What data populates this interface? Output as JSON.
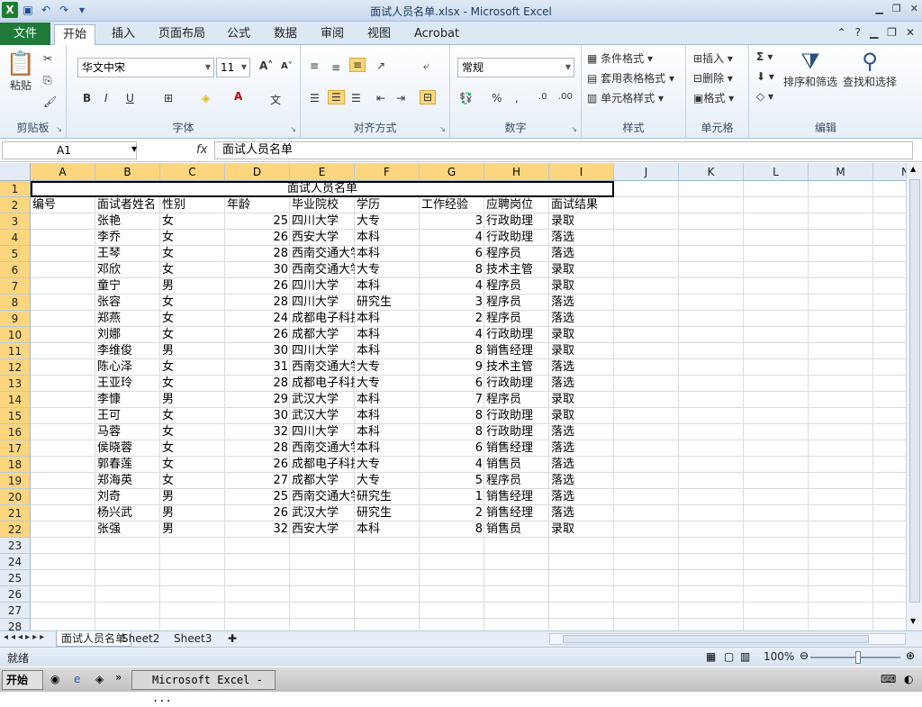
{
  "window": {
    "title": "面试人员名单.xlsx - Microsoft Excel"
  },
  "ribbon_tabs": [
    "文件",
    "开始",
    "插入",
    "页面布局",
    "公式",
    "数据",
    "审阅",
    "视图",
    "Acrobat"
  ],
  "clipboard": {
    "paste": "粘贴",
    "group": "剪贴板"
  },
  "font": {
    "name": "华文中宋",
    "size": "11",
    "group": "字体"
  },
  "alignment": {
    "group": "对齐方式"
  },
  "number": {
    "format": "常规",
    "group": "数字"
  },
  "styles": {
    "conditional": "条件格式",
    "table": "套用表格格式",
    "cell": "单元格样式",
    "group": "样式"
  },
  "cells": {
    "insert": "插入",
    "delete": "删除",
    "format": "格式",
    "group": "单元格"
  },
  "editing": {
    "sort": "排序和筛选",
    "find": "查找和选择",
    "group": "编辑"
  },
  "formula_bar": {
    "namebox": "A1",
    "fx": "fx",
    "content": "面试人员名单"
  },
  "columns": [
    "A",
    "B",
    "C",
    "D",
    "E",
    "F",
    "G",
    "H",
    "I",
    "J",
    "K",
    "L",
    "M",
    "N"
  ],
  "rows": [
    "1",
    "2",
    "3",
    "4",
    "5",
    "6",
    "7",
    "8",
    "9",
    "10",
    "11",
    "12",
    "13",
    "14",
    "15",
    "16",
    "17",
    "18",
    "19",
    "20",
    "21",
    "22",
    "23",
    "24",
    "25",
    "26",
    "27",
    "28"
  ],
  "sheet_title": "面试人员名单",
  "headers": [
    "编号",
    "面试者姓名",
    "性别",
    "年龄",
    "毕业院校",
    "学历",
    "工作经验",
    "应聘岗位",
    "面试结果"
  ],
  "records": [
    [
      "张艳",
      "女",
      "25",
      "四川大学",
      "大专",
      "3",
      "行政助理",
      "录取"
    ],
    [
      "李乔",
      "女",
      "26",
      "西安大学",
      "本科",
      "4",
      "行政助理",
      "落选"
    ],
    [
      "王琴",
      "女",
      "28",
      "西南交通大学",
      "本科",
      "6",
      "程序员",
      "落选"
    ],
    [
      "邓欣",
      "女",
      "30",
      "西南交通大学",
      "大专",
      "8",
      "技术主管",
      "录取"
    ],
    [
      "童宁",
      "男",
      "26",
      "四川大学",
      "本科",
      "4",
      "程序员",
      "录取"
    ],
    [
      "张容",
      "女",
      "28",
      "四川大学",
      "研究生",
      "3",
      "程序员",
      "落选"
    ],
    [
      "郑燕",
      "女",
      "24",
      "成都电子科技大学",
      "本科",
      "2",
      "程序员",
      "落选"
    ],
    [
      "刘娜",
      "女",
      "26",
      "成都大学",
      "本科",
      "4",
      "行政助理",
      "录取"
    ],
    [
      "李维俊",
      "男",
      "30",
      "四川大学",
      "本科",
      "8",
      "销售经理",
      "录取"
    ],
    [
      "陈心泽",
      "女",
      "31",
      "西南交通大学",
      "大专",
      "9",
      "技术主管",
      "落选"
    ],
    [
      "王亚玲",
      "女",
      "28",
      "成都电子科技大学",
      "大专",
      "6",
      "行政助理",
      "落选"
    ],
    [
      "李慷",
      "男",
      "29",
      "武汉大学",
      "本科",
      "7",
      "程序员",
      "录取"
    ],
    [
      "王可",
      "女",
      "30",
      "武汉大学",
      "本科",
      "8",
      "行政助理",
      "录取"
    ],
    [
      "马蓉",
      "女",
      "32",
      "四川大学",
      "本科",
      "8",
      "行政助理",
      "落选"
    ],
    [
      "侯晓蓉",
      "女",
      "28",
      "西南交通大学",
      "本科",
      "6",
      "销售经理",
      "落选"
    ],
    [
      "郭春莲",
      "女",
      "26",
      "成都电子科技大学",
      "大专",
      "4",
      "销售员",
      "落选"
    ],
    [
      "郑海英",
      "女",
      "27",
      "成都大学",
      "大专",
      "5",
      "程序员",
      "落选"
    ],
    [
      "刘奇",
      "男",
      "25",
      "西南交通大学",
      "研究生",
      "1",
      "销售经理",
      "落选"
    ],
    [
      "杨兴武",
      "男",
      "26",
      "武汉大学",
      "研究生",
      "2",
      "销售经理",
      "落选"
    ],
    [
      "张强",
      "男",
      "32",
      "西安大学",
      "本科",
      "8",
      "销售员",
      "录取"
    ]
  ],
  "sheets": [
    "面试人员名单",
    "Sheet2",
    "Sheet3"
  ],
  "status": {
    "ready": "就绪",
    "zoom": "100%"
  },
  "taskbar": {
    "start": "开始",
    "item": "Microsoft Excel - ..."
  }
}
